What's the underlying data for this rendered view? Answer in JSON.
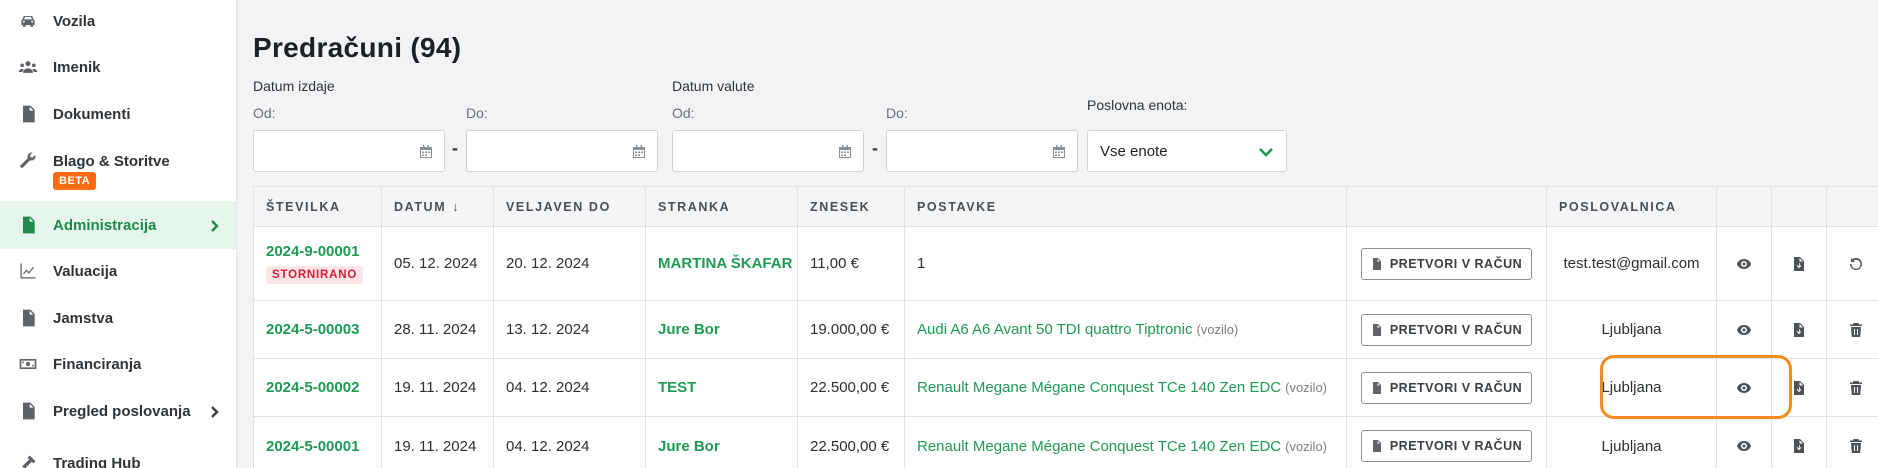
{
  "sidebar": {
    "items": [
      {
        "label": "Vozila",
        "icon": "car-icon"
      },
      {
        "label": "Imenik",
        "icon": "people-icon"
      },
      {
        "label": "Dokumenti",
        "icon": "document-icon"
      },
      {
        "label": "Blago & Storitve",
        "icon": "wrench-icon",
        "badge": "BETA"
      },
      {
        "label": "Administracija",
        "icon": "admin-document-icon",
        "active": true
      },
      {
        "label": "Valuacija",
        "icon": "chart-line-icon"
      },
      {
        "label": "Jamstva",
        "icon": "warranty-icon"
      },
      {
        "label": "Financiranja",
        "icon": "money-icon"
      },
      {
        "label": "Pregled poslovanja",
        "icon": "report-icon"
      },
      {
        "label": "Trading Hub",
        "icon": "hammer-icon"
      }
    ]
  },
  "page": {
    "title": "Predračuni (94)"
  },
  "filters": {
    "issue_date_label": "Datum izdaje",
    "value_date_label": "Datum valute",
    "from_label": "Od:",
    "to_label": "Do:",
    "dash": "-",
    "business_unit_label": "Poslovna enota:",
    "business_unit_value": "Vse enote"
  },
  "table": {
    "headers": [
      "ŠTEVILKA",
      "DATUM",
      "VELJAVEN DO",
      "STRANKA",
      "ZNESEK",
      "POSTAVKE",
      "",
      "POSLOVALNICA",
      "",
      "",
      ""
    ],
    "convert_label": "PRETVORI V RAČUN",
    "rows": [
      {
        "number": "2024-9-00001",
        "status": "STORNIRANO",
        "date": "05. 12. 2024",
        "valid": "20. 12. 2024",
        "customer": "MARTINA ŠKAFAR",
        "amount": "11,00 €",
        "item": "1",
        "item_note": "",
        "branch": "test.test@gmail.com",
        "last_action": "restore"
      },
      {
        "number": "2024-5-00003",
        "status": "",
        "date": "28. 11. 2024",
        "valid": "13. 12. 2024",
        "customer": "Jure Bor",
        "amount": "19.000,00 €",
        "item": "Audi A6 A6 Avant 50 TDI quattro Tiptronic",
        "item_note": "(vozilo)",
        "branch": "Ljubljana",
        "last_action": "delete"
      },
      {
        "number": "2024-5-00002",
        "status": "",
        "date": "19. 11. 2024",
        "valid": "04. 12. 2024",
        "customer": "TEST",
        "amount": "22.500,00 €",
        "item": "Renault Megane Mégane Conquest TCe 140 Zen EDC",
        "item_note": "(vozilo)",
        "branch": "Ljubljana",
        "last_action": "delete"
      },
      {
        "number": "2024-5-00001",
        "status": "",
        "date": "19. 11. 2024",
        "valid": "04. 12. 2024",
        "customer": "Jure Bor",
        "amount": "22.500,00 €",
        "item": "Renault Megane Mégane Conquest TCe 140 Zen EDC",
        "item_note": "(vozilo)",
        "branch": "Ljubljana",
        "last_action": "delete"
      }
    ]
  },
  "colors": {
    "accent": "#1f9a52",
    "highlight": "#f28c1c",
    "badge": "#ff6a13"
  }
}
